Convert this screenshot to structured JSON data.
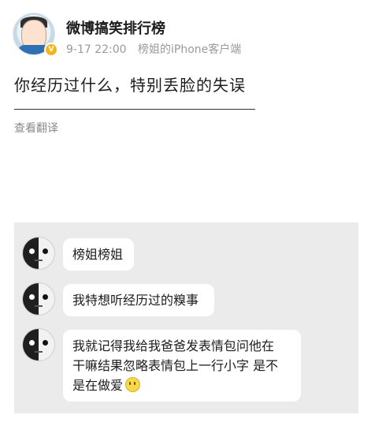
{
  "post": {
    "account_name": "微博搞笑排行榜",
    "timestamp": "9-17 22:00",
    "source": "榜姐的iPhone客户端",
    "text": "你经历过什么，特别丢脸的失误",
    "translate_label": "查看翻译"
  },
  "chat": {
    "messages": [
      {
        "text": "榜姐榜姐"
      },
      {
        "text": "我特想听经历过的糗事"
      },
      {
        "line1": "我就记得我给我爸爸发表情包问他在",
        "line2": "干嘛结果忽略表情包上一行小字 是不",
        "line3": "是在做爱",
        "emoji": "smiling-face-emoji"
      }
    ]
  },
  "colors": {
    "verified_badge": "#f3b51a",
    "meta_text": "#9a9a9a",
    "chat_background": "#ebebeb",
    "bubble": "#ffffff"
  }
}
